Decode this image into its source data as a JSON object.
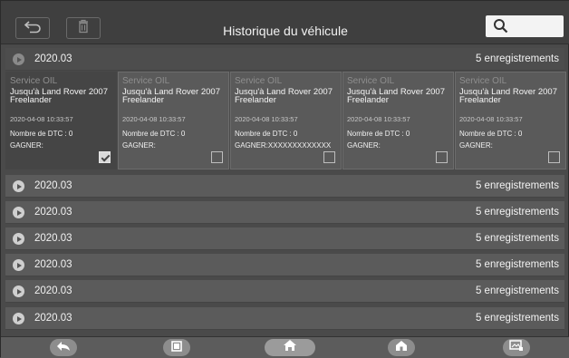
{
  "header": {
    "title": "Historique du véhicule",
    "icons": [
      "back-icon",
      "trash-icon",
      "search-icon"
    ]
  },
  "group_expanded": {
    "label": "2020.03",
    "count": "5 enregistrements"
  },
  "cards": [
    {
      "type": "Service OIL",
      "vehicle": "Jusqu'à Land Rover 2007 Freelander",
      "date": "2020-04-08 10:33:57",
      "dtc": "Nombre de DTC : 0",
      "gagner": "GAGNER:",
      "checked": true
    },
    {
      "type": "Service OIL",
      "vehicle": "Jusqu'à Land Rover 2007 Freelander",
      "date": "2020-04-08 10:33:57",
      "dtc": "Nombre de DTC : 0",
      "gagner": "GAGNER:",
      "checked": false
    },
    {
      "type": "Service OIL",
      "vehicle": "Jusqu'à Land Rover 2007 Freelander",
      "date": "2020-04-08 10:33:57",
      "dtc": "Nombre de DTC : 0",
      "gagner": "GAGNER:XXXXXXXXXXXXX",
      "checked": false
    },
    {
      "type": "Service OIL",
      "vehicle": "Jusqu'à Land Rover 2007 Freelander",
      "date": "2020-04-08 10:33:57",
      "dtc": "Nombre de DTC : 0",
      "gagner": "GAGNER:",
      "checked": false
    },
    {
      "type": "Service OIL",
      "vehicle": "Jusqu'à Land Rover 2007 Freelander",
      "date": "2020-04-08 10:33:57",
      "dtc": "Nombre de DTC : 0",
      "gagner": "GAGNER:",
      "checked": false
    }
  ],
  "groups": [
    {
      "label": "2020.03",
      "count": "5 enregistrements"
    },
    {
      "label": "2020.03",
      "count": "5 enregistrements"
    },
    {
      "label": "2020.03",
      "count": "5 enregistrements"
    },
    {
      "label": "2020.03",
      "count": "5 enregistrements"
    },
    {
      "label": "2020.03",
      "count": "5 enregistrements"
    },
    {
      "label": "2020.03",
      "count": "5 enregistrements"
    }
  ],
  "footer": {
    "icons": [
      "back-icon",
      "recent-apps-icon",
      "home-icon",
      "house-icon",
      "screenshot-icon"
    ]
  }
}
